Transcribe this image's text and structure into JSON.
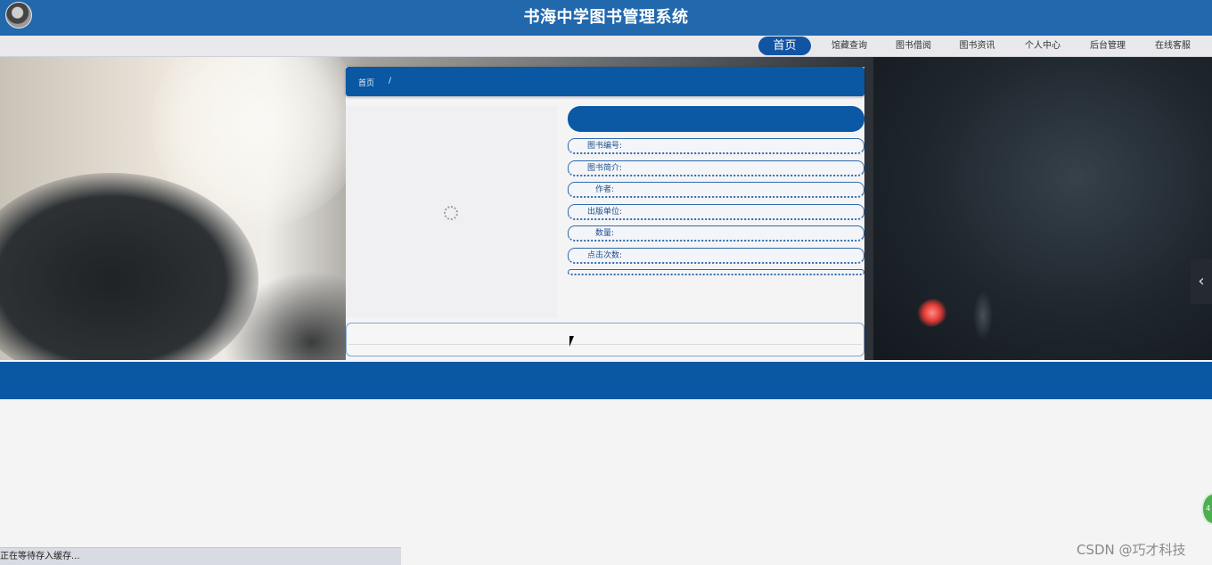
{
  "header": {
    "site_title": "书海中学图书管理系统"
  },
  "nav": {
    "items": [
      {
        "label": "首页",
        "active": true
      },
      {
        "label": "馆藏查询"
      },
      {
        "label": "图书借阅"
      },
      {
        "label": "图书资讯"
      },
      {
        "label": "个人中心"
      },
      {
        "label": "后台管理"
      },
      {
        "label": "在线客服"
      }
    ]
  },
  "breadcrumb": {
    "home": "首页",
    "separator": "/"
  },
  "book_detail": {
    "fields": [
      {
        "label": "图书编号:"
      },
      {
        "label": "图书简介:"
      },
      {
        "label": "作者:"
      },
      {
        "label": "出版单位:"
      },
      {
        "label": "数量:"
      },
      {
        "label": "点击次数:"
      }
    ]
  },
  "status_bar": {
    "text": "正在等待存入缓存..."
  },
  "watermark": {
    "text": "CSDN @巧才科技"
  },
  "float_widget": {
    "text": "4"
  },
  "icons": {
    "carousel_prev": "chevron-left-icon",
    "loading": "loading-spinner-icon"
  },
  "colors": {
    "header_blue": "#2168ad",
    "primary_blue": "#0a57a3",
    "nav_bg": "#e9e9ec"
  }
}
